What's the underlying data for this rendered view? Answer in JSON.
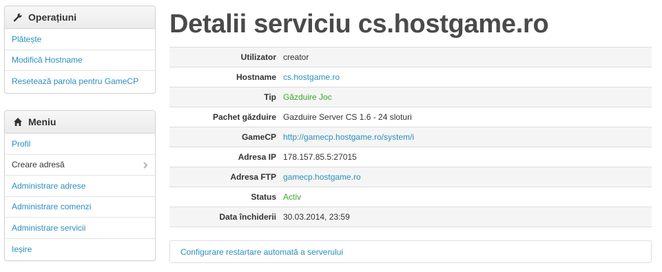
{
  "sidebar": {
    "operations": {
      "title": "Operațiuni",
      "icon": "wrench-icon",
      "items": [
        {
          "label": "Plătește"
        },
        {
          "label": "Modifică Hostname"
        },
        {
          "label": "Resetează parola pentru GameCP"
        }
      ]
    },
    "menu": {
      "title": "Meniu",
      "icon": "home-icon",
      "items": [
        {
          "label": "Profil"
        },
        {
          "label": "Creare adresă",
          "active": true
        },
        {
          "label": "Administrare adrese"
        },
        {
          "label": "Administrare comenzi"
        },
        {
          "label": "Administrare servicii"
        },
        {
          "label": "Ieșire"
        }
      ]
    }
  },
  "main": {
    "title": "Detalii serviciu cs.hostgame.ro",
    "details": [
      {
        "label": "Utilizator",
        "value": "creator"
      },
      {
        "label": "Hostname",
        "value": "cs.hostgame.ro"
      },
      {
        "label": "Tip",
        "value": "Găzduire Joc"
      },
      {
        "label": "Pachet găzduire",
        "value": "Gazduire Server CS 1.6 - 24 sloturi"
      },
      {
        "label": "GameCP",
        "value": "http://gamecp.hostgame.ro/system/i"
      },
      {
        "label": "Adresa IP",
        "value": "178.157.85.5:27015"
      },
      {
        "label": "Adresa FTP",
        "value": "gamecp.hostgame.ro"
      },
      {
        "label": "Status",
        "value": "Activ"
      },
      {
        "label": "Data închiderii",
        "value": "30.03.2014, 23:59"
      }
    ],
    "config_link": "Configurare restartare automată a serverului"
  },
  "colors": {
    "link": "#2a8fbd",
    "green": "#3aa52f",
    "title": "#4a4a4a"
  }
}
